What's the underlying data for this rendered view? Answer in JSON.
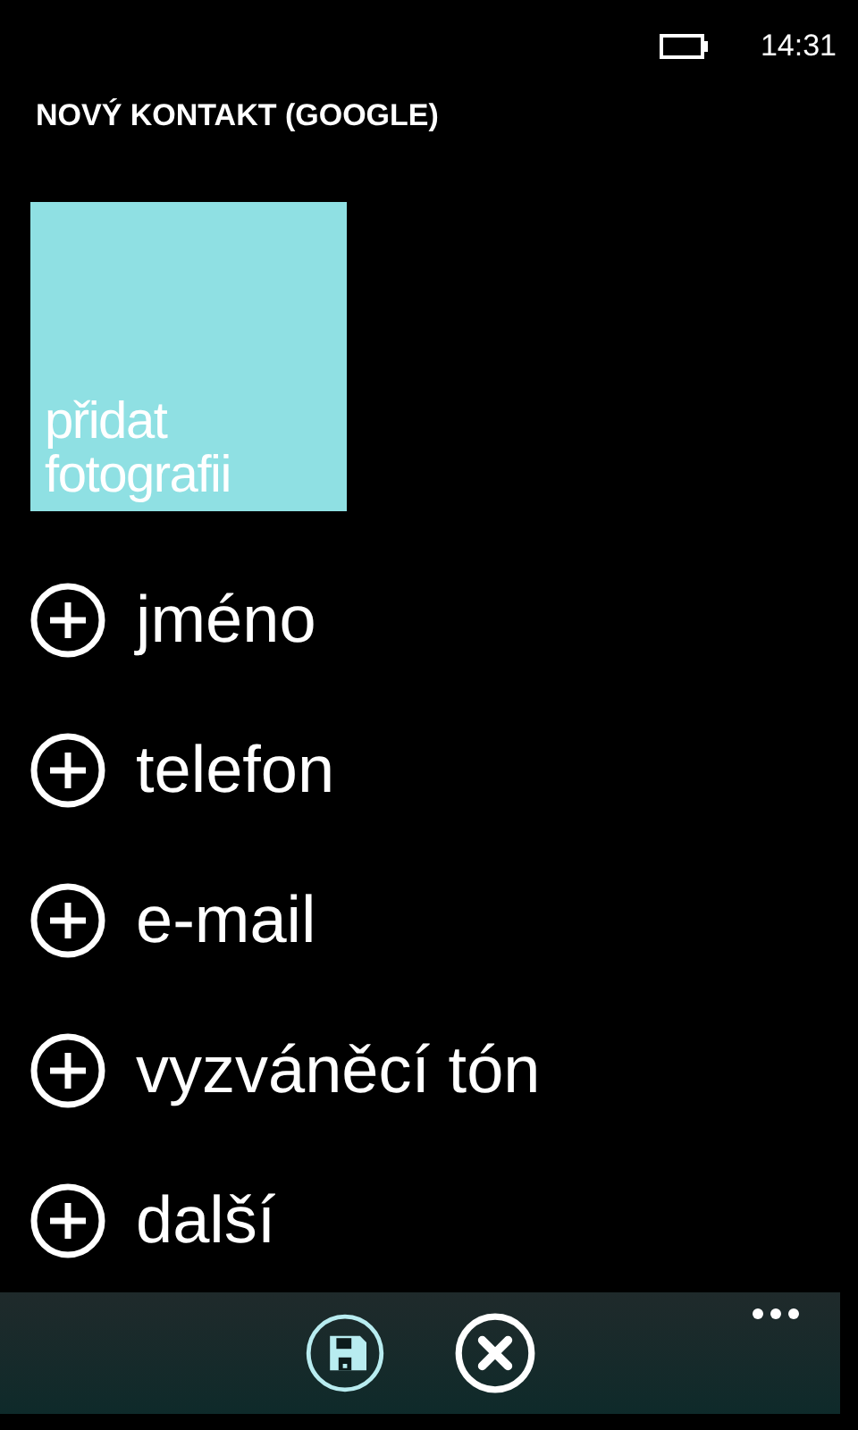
{
  "status_bar": {
    "time": "14:31"
  },
  "title": "NOVÝ KONTAKT (GOOGLE)",
  "photo_tile": {
    "label": "přidat fotografii"
  },
  "fields": [
    {
      "label": "jméno"
    },
    {
      "label": "telefon"
    },
    {
      "label": "e-mail"
    },
    {
      "label": "vyzváněcí tón"
    },
    {
      "label": "další"
    }
  ],
  "app_bar": {
    "buttons": [
      {
        "kind": "save",
        "disabled": true
      },
      {
        "kind": "cancel",
        "disabled": false
      }
    ]
  }
}
